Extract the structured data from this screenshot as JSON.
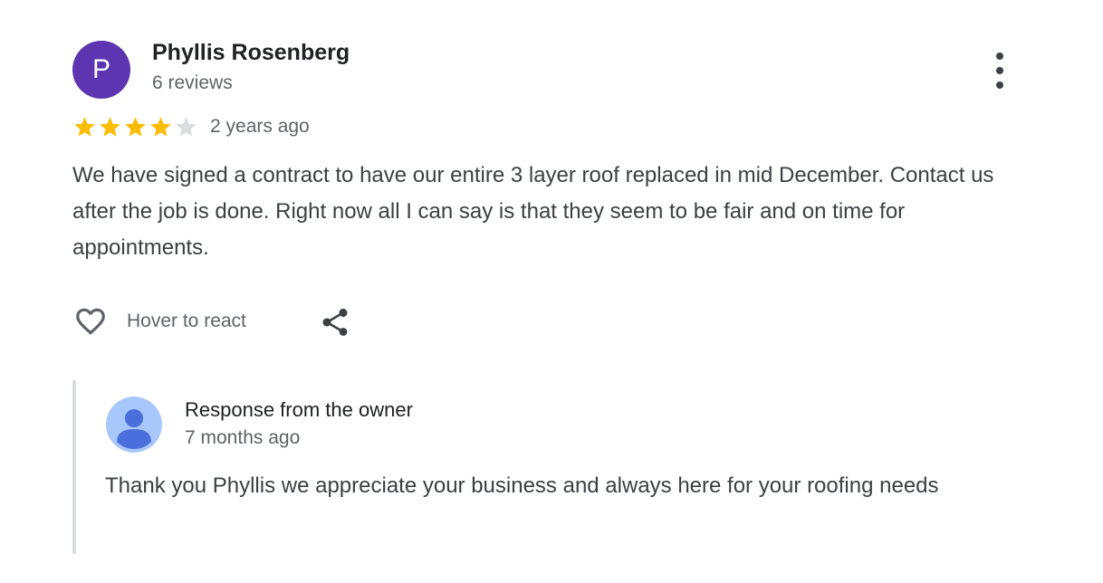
{
  "review": {
    "avatar_letter": "P",
    "avatar_color": "#5e35b1",
    "reviewer_name": "Phyllis Rosenberg",
    "review_count": "6 reviews",
    "rating": 4,
    "rating_max": 5,
    "star_color": "#fbbc04",
    "star_empty_color": "#dadce0",
    "date": "2 years ago",
    "text": "We have signed a contract to have our entire 3 layer roof replaced in mid December. Contact us after the job is done. Right now all I can say is that they seem to be fair and on time for appointments.",
    "react_label": "Hover to react",
    "react_icon": "heart-outline-icon",
    "share_icon": "share-icon",
    "more_icon": "more-vert-icon"
  },
  "owner_response": {
    "title": "Response from the owner",
    "date": "7 months ago",
    "text": "Thank you Phyllis we appreciate your business and always here for your roofing needs",
    "avatar_icon": "person-icon"
  }
}
